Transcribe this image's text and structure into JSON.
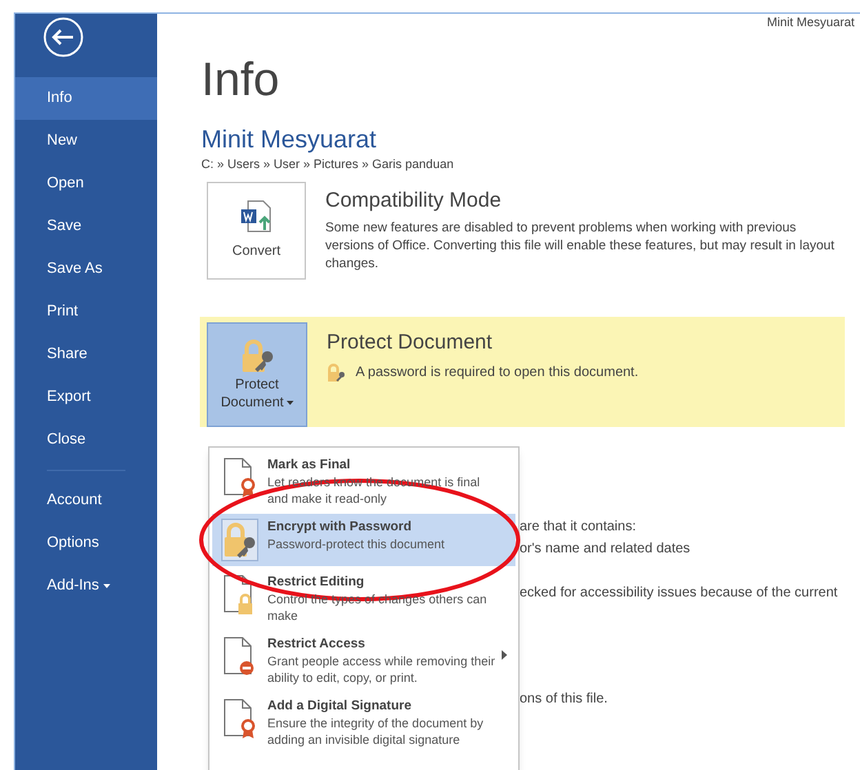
{
  "window_title": "Minit Mesyuarat",
  "sidebar": {
    "items": [
      {
        "label": "Info",
        "selected": true
      },
      {
        "label": "New",
        "selected": false
      },
      {
        "label": "Open",
        "selected": false
      },
      {
        "label": "Save",
        "selected": false
      },
      {
        "label": "Save As",
        "selected": false
      },
      {
        "label": "Print",
        "selected": false
      },
      {
        "label": "Share",
        "selected": false
      },
      {
        "label": "Export",
        "selected": false
      },
      {
        "label": "Close",
        "selected": false
      },
      {
        "kind": "divider"
      },
      {
        "label": "Account",
        "selected": false
      },
      {
        "label": "Options",
        "selected": false
      },
      {
        "label": "Add-Ins",
        "selected": false,
        "has_dropdown": true
      }
    ]
  },
  "page_title": "Info",
  "document": {
    "name": "Minit Mesyuarat",
    "path": "C: » Users » User » Pictures » Garis panduan"
  },
  "compatibility": {
    "button": "Convert",
    "title": "Compatibility Mode",
    "description": "Some new features are disabled to prevent problems when working with previous versions of Office. Converting this file will enable these features, but may result in layout changes."
  },
  "protect": {
    "button_line1": "Protect",
    "button_line2": "Document",
    "title": "Protect Document",
    "status": "A password is required to open this document."
  },
  "protect_menu": [
    {
      "kind": "final",
      "title": "Mark as Final",
      "description": "Let readers know the document is final and make it read-only",
      "selected": false,
      "has_submenu": false
    },
    {
      "kind": "encrypt",
      "title": "Encrypt with Password",
      "description": "Password-protect this document",
      "selected": true,
      "has_submenu": false
    },
    {
      "kind": "editing",
      "title": "Restrict Editing",
      "description": "Control the types of changes others can make",
      "selected": false,
      "has_submenu": false
    },
    {
      "kind": "access",
      "title": "Restrict Access",
      "description": "Grant people access while removing their ability to edit, copy, or print.",
      "selected": false,
      "has_submenu": true
    },
    {
      "kind": "signature",
      "title": "Add a Digital Signature",
      "description": "Ensure the integrity of the document by adding an invisible digital signature",
      "selected": false,
      "has_submenu": false
    }
  ],
  "hidden_texts": [
    "are that it contains:",
    "or's name and related dates",
    "ecked for accessibility issues because of the current",
    "ons of this file."
  ],
  "annotation": {
    "kind": "ellipse",
    "color": "#e8121b"
  }
}
